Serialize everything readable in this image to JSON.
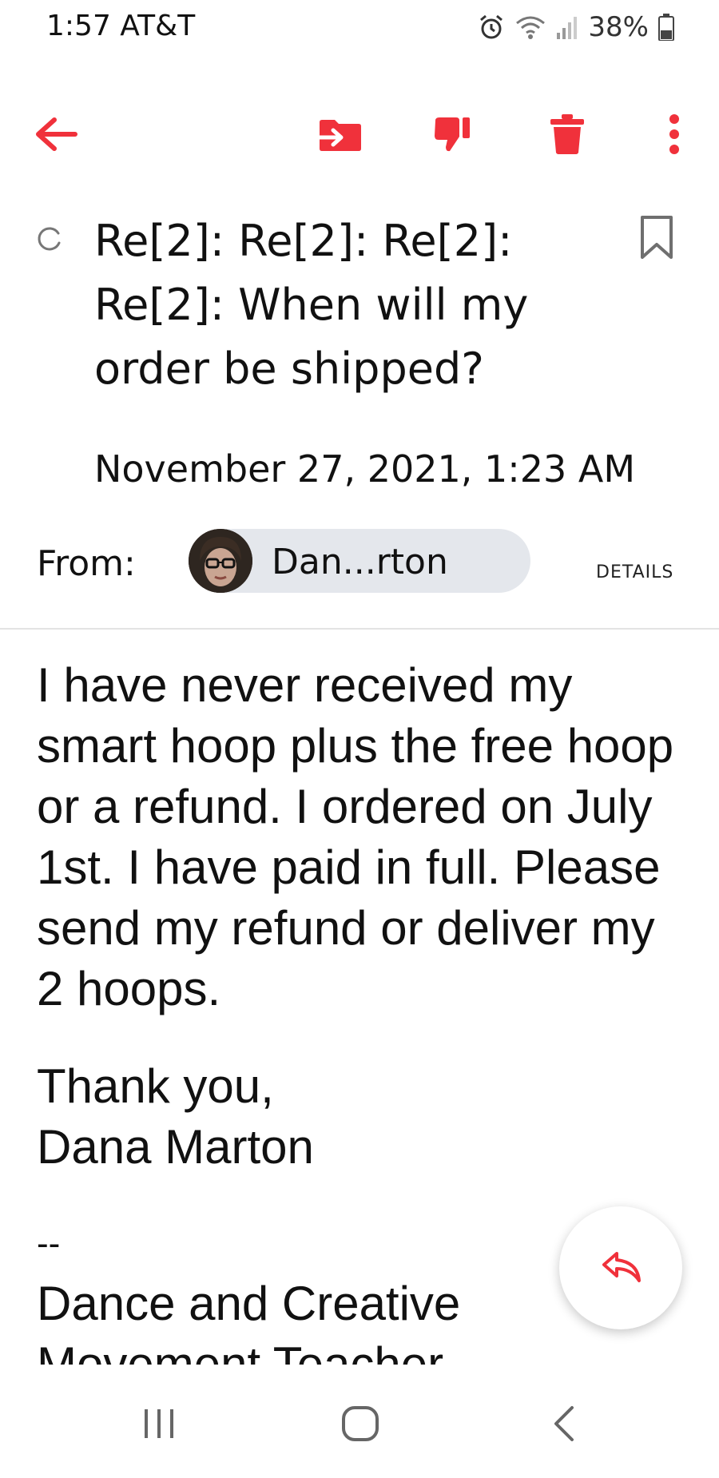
{
  "status_bar": {
    "time": "1:57",
    "carrier": "AT&T",
    "battery": "38%"
  },
  "toolbar": {
    "icons": [
      "back-arrow-icon",
      "move-to-folder-icon",
      "spam-thumbs-down-icon",
      "delete-trash-icon",
      "more-options-icon"
    ],
    "accent_color": "#f0313b"
  },
  "email": {
    "subject": "Re[2]: Re[2]: Re[2]: Re[2]: When will my order be shipped?",
    "date": "November 27, 2021, 1:23 AM",
    "from_label": "From:",
    "sender_name": "Dan...rton",
    "details_link": "DETAILS",
    "body_paragraph": "I have never received my smart hoop plus the free hoop or a refund. I ordered on July 1st. I have paid in full. Please send my refund or deliver my 2 hoops.",
    "signoff_line1": "Thank you,",
    "signoff_line2": "Dana Marton",
    "separator": "--",
    "signature_line1": "Dance and Creative",
    "signature_line2": "Movement Teacher"
  },
  "nav_bar": {
    "icons": [
      "recent-apps-icon",
      "home-icon",
      "back-nav-icon"
    ]
  }
}
